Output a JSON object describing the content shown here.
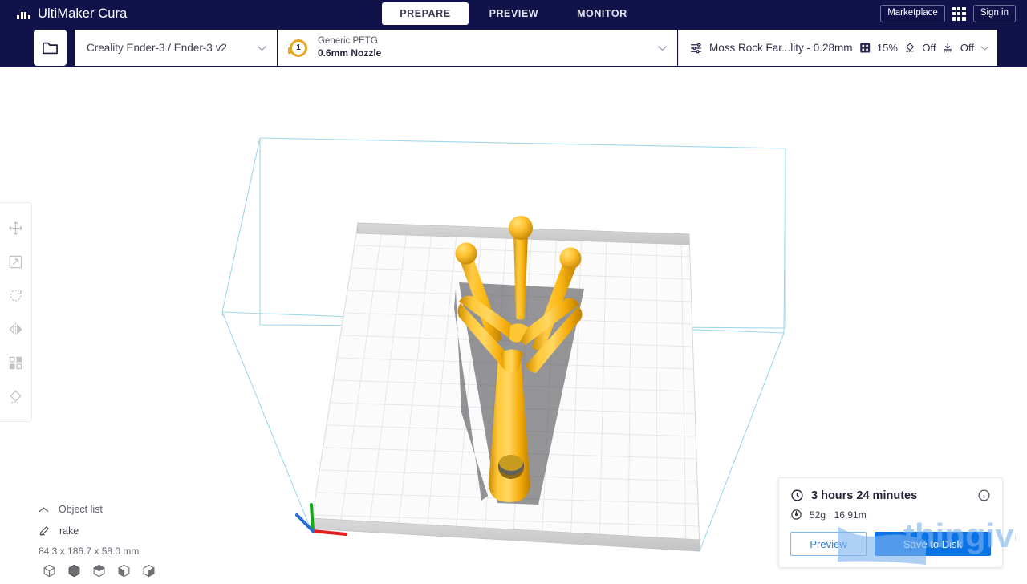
{
  "app": {
    "name": "UltiMaker Cura",
    "logo_icon": "ultimaker-logo-icon",
    "header_bg": "#12124a",
    "accent_blue": "#0a73e8"
  },
  "tabs": [
    {
      "label": "PREPARE",
      "active": true
    },
    {
      "label": "PREVIEW",
      "active": false
    },
    {
      "label": "MONITOR",
      "active": false
    }
  ],
  "topright": {
    "marketplace_label": "Marketplace",
    "apps_icon": "apps-grid-icon",
    "signin_label": "Sign in"
  },
  "toolbar": {
    "open_file_icon": "folder-icon",
    "machine": {
      "label": "Creality Ender-3 / Ender-3 v2",
      "chevron_icon": "chevron-down-icon"
    },
    "material": {
      "extruder_number": "1",
      "name": "Generic PETG",
      "nozzle": "0.6mm Nozzle",
      "chevron_icon": "chevron-down-icon"
    },
    "profile": {
      "settings_icon": "sliders-icon",
      "name": "Moss Rock Far...lity - 0.28mm",
      "infill_icon": "infill-icon",
      "infill_value": "15%",
      "support_icon": "support-icon",
      "support_value": "Off",
      "adhesion_icon": "adhesion-icon",
      "adhesion_value": "Off",
      "chevron_icon": "chevron-down-icon"
    }
  },
  "tools": [
    {
      "name": "move-tool",
      "icon": "move-icon"
    },
    {
      "name": "scale-tool",
      "icon": "scale-icon"
    },
    {
      "name": "rotate-tool",
      "icon": "rotate-icon"
    },
    {
      "name": "mirror-tool",
      "icon": "mirror-icon"
    },
    {
      "name": "per-model-settings-tool",
      "icon": "per-model-settings-icon"
    },
    {
      "name": "support-blocker-tool",
      "icon": "support-blocker-icon"
    }
  ],
  "object_list": {
    "toggle_icon": "chevron-up-icon",
    "title": "Object list",
    "item_icon": "mesh-type-icon",
    "item_name": "rake",
    "dimensions": "84.3 x 186.7 x 58.0 mm"
  },
  "view_modes": [
    {
      "name": "view-3d",
      "icon": "cube-wireframe-icon"
    },
    {
      "name": "view-front",
      "icon": "cube-front-icon"
    },
    {
      "name": "view-top",
      "icon": "cube-top-icon"
    },
    {
      "name": "view-left",
      "icon": "cube-left-icon"
    },
    {
      "name": "view-right",
      "icon": "cube-right-icon"
    }
  ],
  "print_info": {
    "time_icon": "clock-icon",
    "time": "3 hours 24 minutes",
    "material_icon": "spool-icon",
    "material": "52g · 16.91m",
    "info_icon": "info-icon",
    "preview_label": "Preview",
    "save_label": "Save to Disk"
  },
  "scene": {
    "model_name": "rake",
    "model_color": "#ffb71b",
    "shadow_color": "#6d6d72",
    "buildplate_color": "#f2f2f2",
    "buildvolume_line_color": "#8fd0e6",
    "axis_x_color": "#e02020",
    "axis_y_color": "#2a6fd6",
    "axis_z_color": "#17a81a"
  },
  "watermark": {
    "text": "thingiverse",
    "color": "#7fb4f0"
  }
}
